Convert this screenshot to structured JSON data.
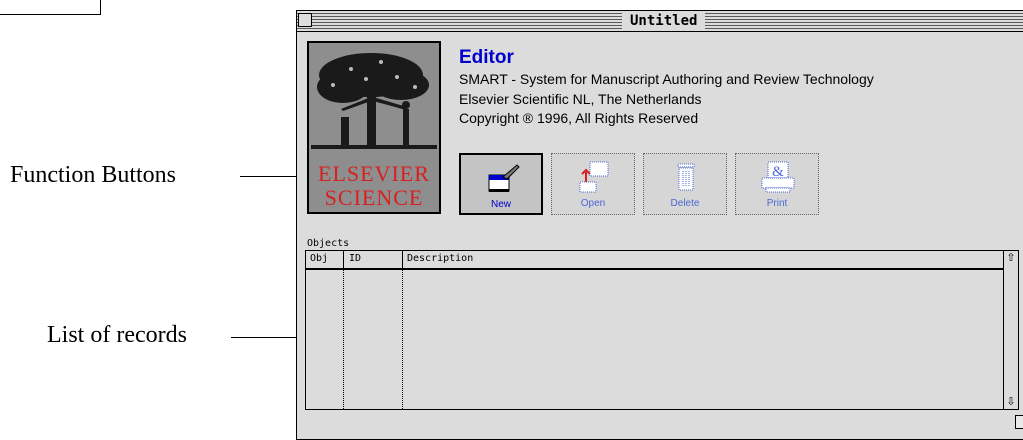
{
  "window": {
    "title": "Untitled"
  },
  "logo": {
    "line1": "ELSEVIER",
    "line2": "SCIENCE"
  },
  "header": {
    "app_title": "Editor",
    "info_lines": [
      "SMART - System for Manuscript Authoring and Review Technology",
      "Elsevier Scientific NL, The Netherlands",
      "Copyright ® 1996, All Rights Reserved"
    ]
  },
  "buttons": [
    {
      "label": "New",
      "icon": "new-document-icon",
      "state": "enabled"
    },
    {
      "label": "Open",
      "icon": "open-document-icon",
      "state": "disabled"
    },
    {
      "label": "Delete",
      "icon": "trash-icon",
      "state": "disabled"
    },
    {
      "label": "Print",
      "icon": "printer-icon",
      "state": "disabled"
    }
  ],
  "objects": {
    "label": "Objects",
    "columns": [
      "Obj",
      "ID",
      "Description"
    ],
    "rows": []
  },
  "annotations": {
    "function_buttons": "Function Buttons",
    "list_of_records": "List of records"
  },
  "colors": {
    "accent": "#0000cc",
    "logo_red": "#d92020",
    "window_bg": "#dcdcdc"
  }
}
